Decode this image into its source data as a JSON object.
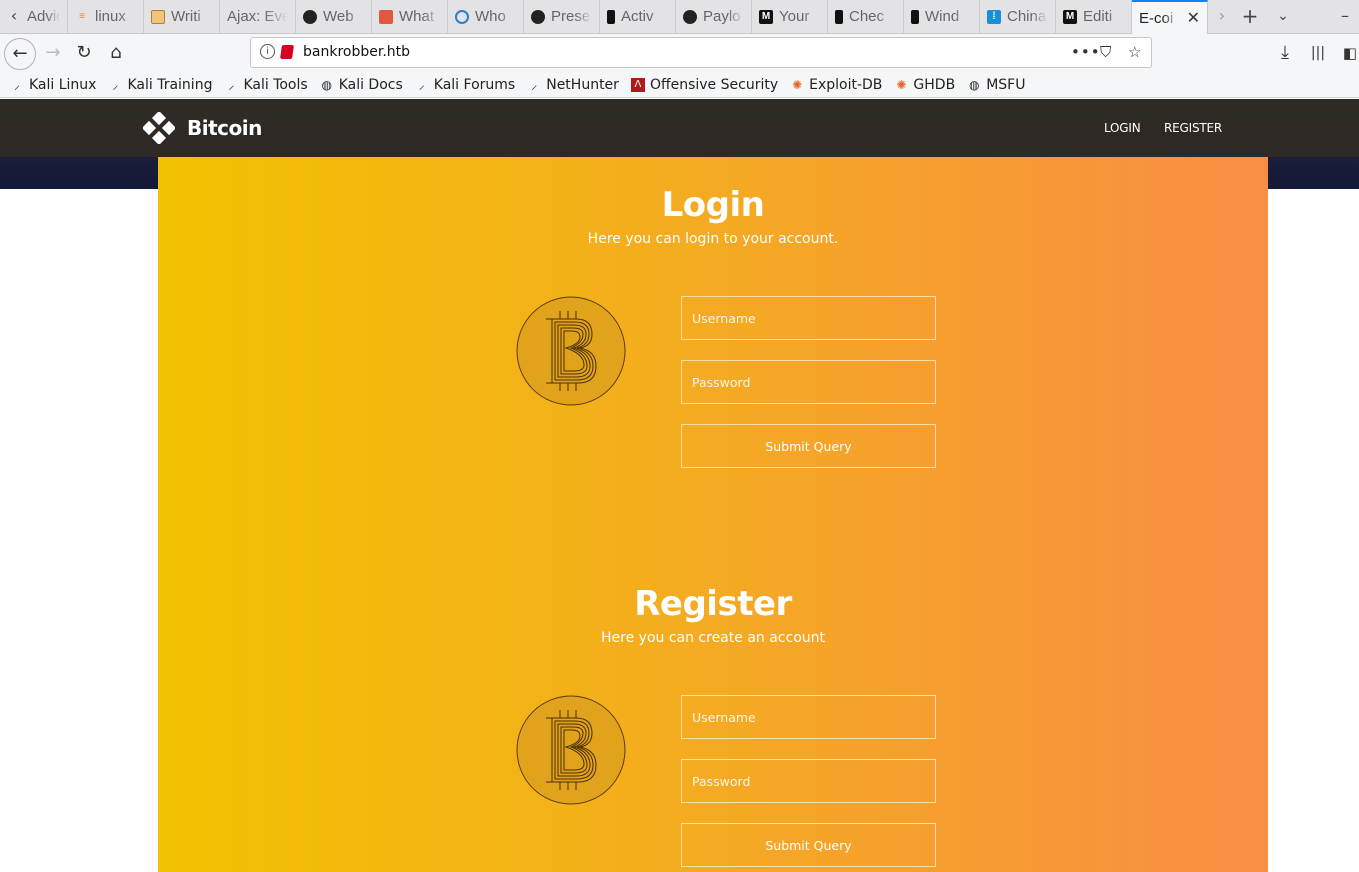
{
  "browser": {
    "tabs": [
      {
        "label": "Advic",
        "icon": "generic-page-icon",
        "left": 0
      },
      {
        "label": "linux",
        "icon": "stackoverflow-icon"
      },
      {
        "label": "Writi",
        "icon": "notepad-icon"
      },
      {
        "label": "Ajax: Eve",
        "icon": ""
      },
      {
        "label": "Web",
        "icon": "github-icon"
      },
      {
        "label": "What",
        "icon": "brand-icon"
      },
      {
        "label": "Who",
        "icon": "globe-icon"
      },
      {
        "label": "Prese",
        "icon": "github-icon"
      },
      {
        "label": "Activ",
        "icon": "kali-icon"
      },
      {
        "label": "Paylo",
        "icon": "github-icon"
      },
      {
        "label": "Your",
        "icon": "medium-icon"
      },
      {
        "label": "Chec",
        "icon": "kali-icon"
      },
      {
        "label": "Wind",
        "icon": "kali-icon"
      },
      {
        "label": "China",
        "icon": "chart-icon"
      },
      {
        "label": "Editi",
        "icon": "medium-icon"
      },
      {
        "label": "E-coi",
        "icon": "",
        "active": true
      }
    ],
    "url": "bankrobber.htb",
    "bookmarks": [
      {
        "label": "Kali Linux",
        "icon": "kali-dragon-icon"
      },
      {
        "label": "Kali Training",
        "icon": "kali-dragon-icon"
      },
      {
        "label": "Kali Tools",
        "icon": "kali-dragon-icon"
      },
      {
        "label": "Kali Docs",
        "icon": "globe-icon"
      },
      {
        "label": "Kali Forums",
        "icon": "kali-dragon-icon"
      },
      {
        "label": "NetHunter",
        "icon": "kali-dragon-icon"
      },
      {
        "label": "Offensive Security",
        "icon": "offsec-icon"
      },
      {
        "label": "Exploit-DB",
        "icon": "exploitdb-icon"
      },
      {
        "label": "GHDB",
        "icon": "exploitdb-icon"
      },
      {
        "label": "MSFU",
        "icon": "globe-icon"
      }
    ]
  },
  "site": {
    "brand": "Bitcoin",
    "nav": {
      "login": "LOGIN",
      "register": "REGISTER"
    },
    "login": {
      "title": "Login",
      "subtitle": "Here you can login to your account.",
      "username_placeholder": "Username",
      "password_placeholder": "Password",
      "submit": "Submit Query"
    },
    "register": {
      "title": "Register",
      "subtitle": "Here you can create an account",
      "username_placeholder": "Username",
      "password_placeholder": "Password",
      "submit": "Submit Query"
    }
  },
  "colors": {
    "gradient_start": "#f1c200",
    "gradient_end": "#f88d44",
    "header_bg": "#302a23",
    "coin": "#e1a31d",
    "tab_accent": "#0a84ff"
  }
}
